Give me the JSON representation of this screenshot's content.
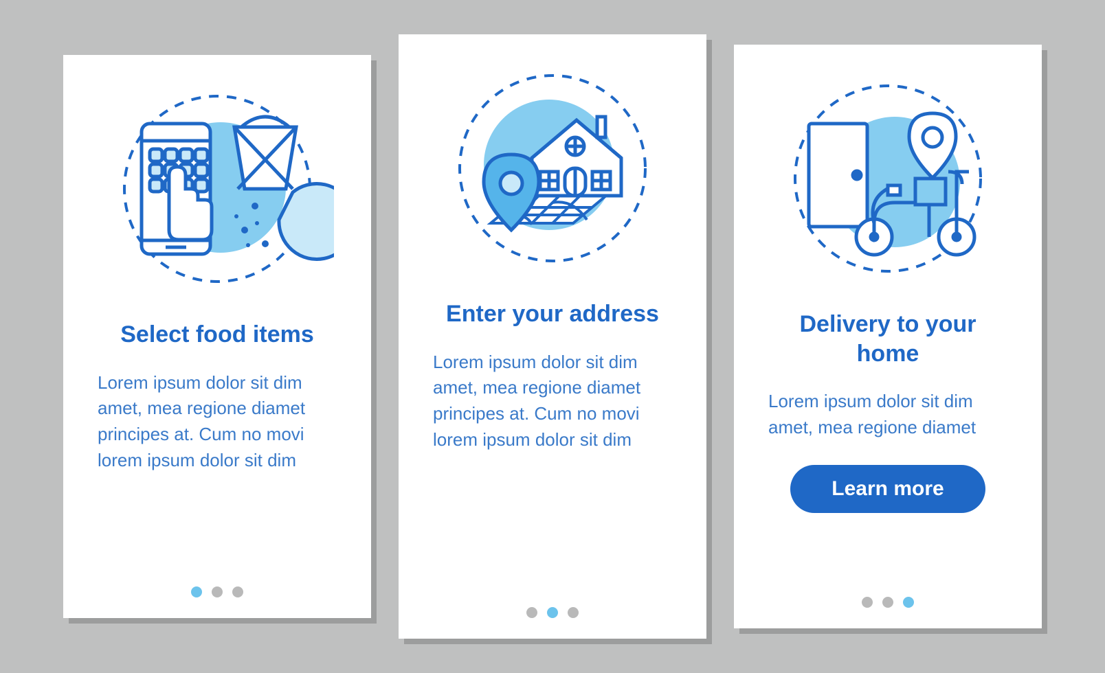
{
  "colors": {
    "primary": "#1f68c6",
    "accent": "#6cc3ec"
  },
  "cards": [
    {
      "title": "Select food items",
      "body": "Lorem ipsum dolor sit dim amet, mea regione diamet principes at. Cum no movi lorem ipsum dolor sit dim",
      "dots": 3,
      "active_dot": 0,
      "button": null,
      "icon": "select-food-icon"
    },
    {
      "title": "Enter your address",
      "body": "Lorem ipsum dolor sit dim amet, mea regione diamet principes at. Cum no movi lorem ipsum dolor sit dim",
      "dots": 3,
      "active_dot": 1,
      "button": null,
      "icon": "address-icon"
    },
    {
      "title": "Delivery to your home",
      "body": "Lorem ipsum dolor sit dim amet, mea regione diamet",
      "dots": 3,
      "active_dot": 2,
      "button": "Learn more",
      "icon": "delivery-icon"
    }
  ]
}
